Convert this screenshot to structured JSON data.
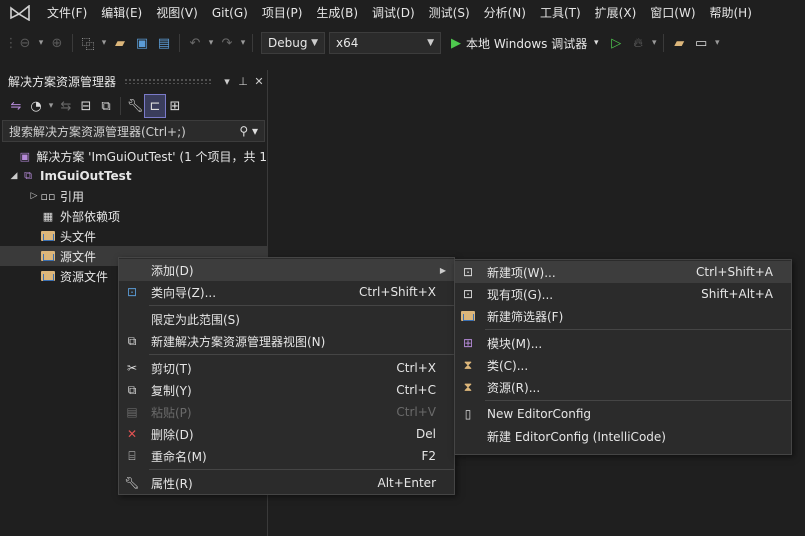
{
  "menubar": {
    "items": [
      "文件(F)",
      "编辑(E)",
      "视图(V)",
      "Git(G)",
      "项目(P)",
      "生成(B)",
      "调试(D)",
      "测试(S)",
      "分析(N)",
      "工具(T)",
      "扩展(X)",
      "窗口(W)",
      "帮助(H)"
    ]
  },
  "toolbar": {
    "config": "Debug",
    "platform": "x64",
    "run_label": "本地 Windows 调试器"
  },
  "solution_explorer": {
    "title": "解决方案资源管理器",
    "search_placeholder": "搜索解决方案资源管理器(Ctrl+;)",
    "tree": {
      "solution": "解决方案 'ImGuiOutTest' (1 个项目，共 1",
      "project": "ImGuiOutTest",
      "references": "引用",
      "external_deps": "外部依赖项",
      "header_files": "头文件",
      "source_files": "源文件",
      "resource_files": "资源文件"
    }
  },
  "context_menu": {
    "items": {
      "add": {
        "label": "添加(D)",
        "shortcut": ""
      },
      "class_wizard": {
        "label": "类向导(Z)...",
        "shortcut": "Ctrl+Shift+X"
      },
      "scope": {
        "label": "限定为此范围(S)",
        "shortcut": ""
      },
      "new_view": {
        "label": "新建解决方案资源管理器视图(N)",
        "shortcut": ""
      },
      "cut": {
        "label": "剪切(T)",
        "shortcut": "Ctrl+X"
      },
      "copy": {
        "label": "复制(Y)",
        "shortcut": "Ctrl+C"
      },
      "paste": {
        "label": "粘贴(P)",
        "shortcut": "Ctrl+V"
      },
      "delete": {
        "label": "删除(D)",
        "shortcut": "Del"
      },
      "rename": {
        "label": "重命名(M)",
        "shortcut": "F2"
      },
      "properties": {
        "label": "属性(R)",
        "shortcut": "Alt+Enter"
      }
    }
  },
  "submenu": {
    "items": {
      "new_item": {
        "label": "新建项(W)...",
        "shortcut": "Ctrl+Shift+A"
      },
      "existing_item": {
        "label": "现有项(G)...",
        "shortcut": "Shift+Alt+A"
      },
      "new_filter": {
        "label": "新建筛选器(F)",
        "shortcut": ""
      },
      "module": {
        "label": "模块(M)...",
        "shortcut": ""
      },
      "class": {
        "label": "类(C)...",
        "shortcut": ""
      },
      "resource": {
        "label": "资源(R)...",
        "shortcut": ""
      },
      "editorconfig": {
        "label": "New EditorConfig",
        "shortcut": ""
      },
      "editorconfig_ic": {
        "label": "新建 EditorConfig (IntelliCode)",
        "shortcut": ""
      }
    }
  },
  "colors": {
    "accent": "#7a7ac8",
    "run_green": "#4ec94e",
    "folder": "#dcb67a",
    "delete_red": "#e05252",
    "background": "#1f1f1f",
    "menu_bg": "#2b2b2b"
  }
}
